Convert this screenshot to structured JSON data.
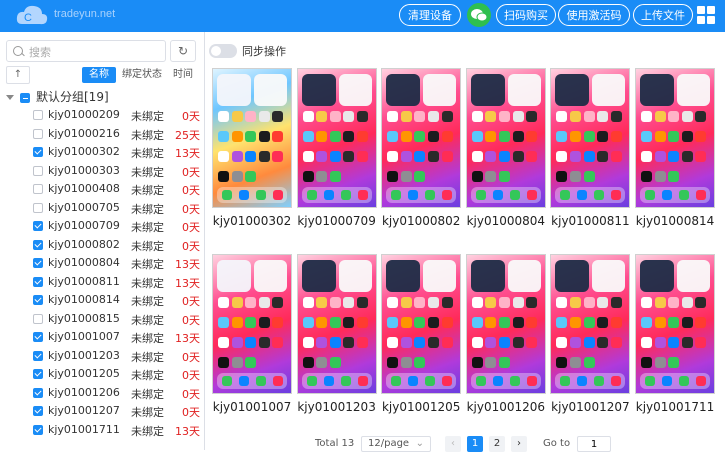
{
  "header": {
    "logo_text": "tradeyun.net",
    "buttons": [
      {
        "label": "清理设备"
      },
      {
        "label": "扫码购买"
      },
      {
        "label": "使用激活码"
      },
      {
        "label": "上传文件"
      }
    ],
    "colors": {
      "topbar": "#1a8cf6",
      "wechat": "#2fbf4f"
    }
  },
  "sidebar": {
    "search_placeholder": "搜索",
    "refresh_glyph": "↻",
    "sort_glyph": "↑",
    "sort_tabs": [
      {
        "label": "名称",
        "active": true
      },
      {
        "label": "绑定状态",
        "active": false
      },
      {
        "label": "时间",
        "active": false
      }
    ],
    "group_label": "默认分组[19]",
    "devices": [
      {
        "name": "kjy01000209",
        "status": "未绑定",
        "days": "0天",
        "checked": false
      },
      {
        "name": "kjy01000216",
        "status": "未绑定",
        "days": "25天",
        "checked": false
      },
      {
        "name": "kjy01000302",
        "status": "未绑定",
        "days": "13天",
        "checked": true
      },
      {
        "name": "kjy01000303",
        "status": "未绑定",
        "days": "0天",
        "checked": false
      },
      {
        "name": "kjy01000408",
        "status": "未绑定",
        "days": "0天",
        "checked": false
      },
      {
        "name": "kjy01000705",
        "status": "未绑定",
        "days": "0天",
        "checked": false
      },
      {
        "name": "kjy01000709",
        "status": "未绑定",
        "days": "0天",
        "checked": true
      },
      {
        "name": "kjy01000802",
        "status": "未绑定",
        "days": "0天",
        "checked": true
      },
      {
        "name": "kjy01000804",
        "status": "未绑定",
        "days": "13天",
        "checked": true
      },
      {
        "name": "kjy01000811",
        "status": "未绑定",
        "days": "13天",
        "checked": true
      },
      {
        "name": "kjy01000814",
        "status": "未绑定",
        "days": "0天",
        "checked": true
      },
      {
        "name": "kjy01000815",
        "status": "未绑定",
        "days": "0天",
        "checked": false
      },
      {
        "name": "kjy01001007",
        "status": "未绑定",
        "days": "13天",
        "checked": true
      },
      {
        "name": "kjy01001203",
        "status": "未绑定",
        "days": "0天",
        "checked": true
      },
      {
        "name": "kjy01001205",
        "status": "未绑定",
        "days": "0天",
        "checked": true
      },
      {
        "name": "kjy01001206",
        "status": "未绑定",
        "days": "0天",
        "checked": true
      },
      {
        "name": "kjy01001207",
        "status": "未绑定",
        "days": "0天",
        "checked": true
      },
      {
        "name": "kjy01001711",
        "status": "未绑定",
        "days": "13天",
        "checked": true
      }
    ]
  },
  "main": {
    "sync_label": "同步操作",
    "screens": [
      {
        "label": "kjy01000302"
      },
      {
        "label": "kjy01000709"
      },
      {
        "label": "kjy01000802"
      },
      {
        "label": "kjy01000804"
      },
      {
        "label": "kjy01000811"
      },
      {
        "label": "kjy01000814"
      },
      {
        "label": "kjy01001007"
      },
      {
        "label": "kjy01001203"
      },
      {
        "label": "kjy01001205"
      },
      {
        "label": "kjy01001206"
      },
      {
        "label": "kjy01001207"
      },
      {
        "label": "kjy01001711"
      }
    ],
    "pagination": {
      "total": "Total 13",
      "page_size": "12/page",
      "pages": [
        "1",
        "2"
      ],
      "current": "1",
      "goto_label": "Go to",
      "goto_value": "1"
    }
  }
}
